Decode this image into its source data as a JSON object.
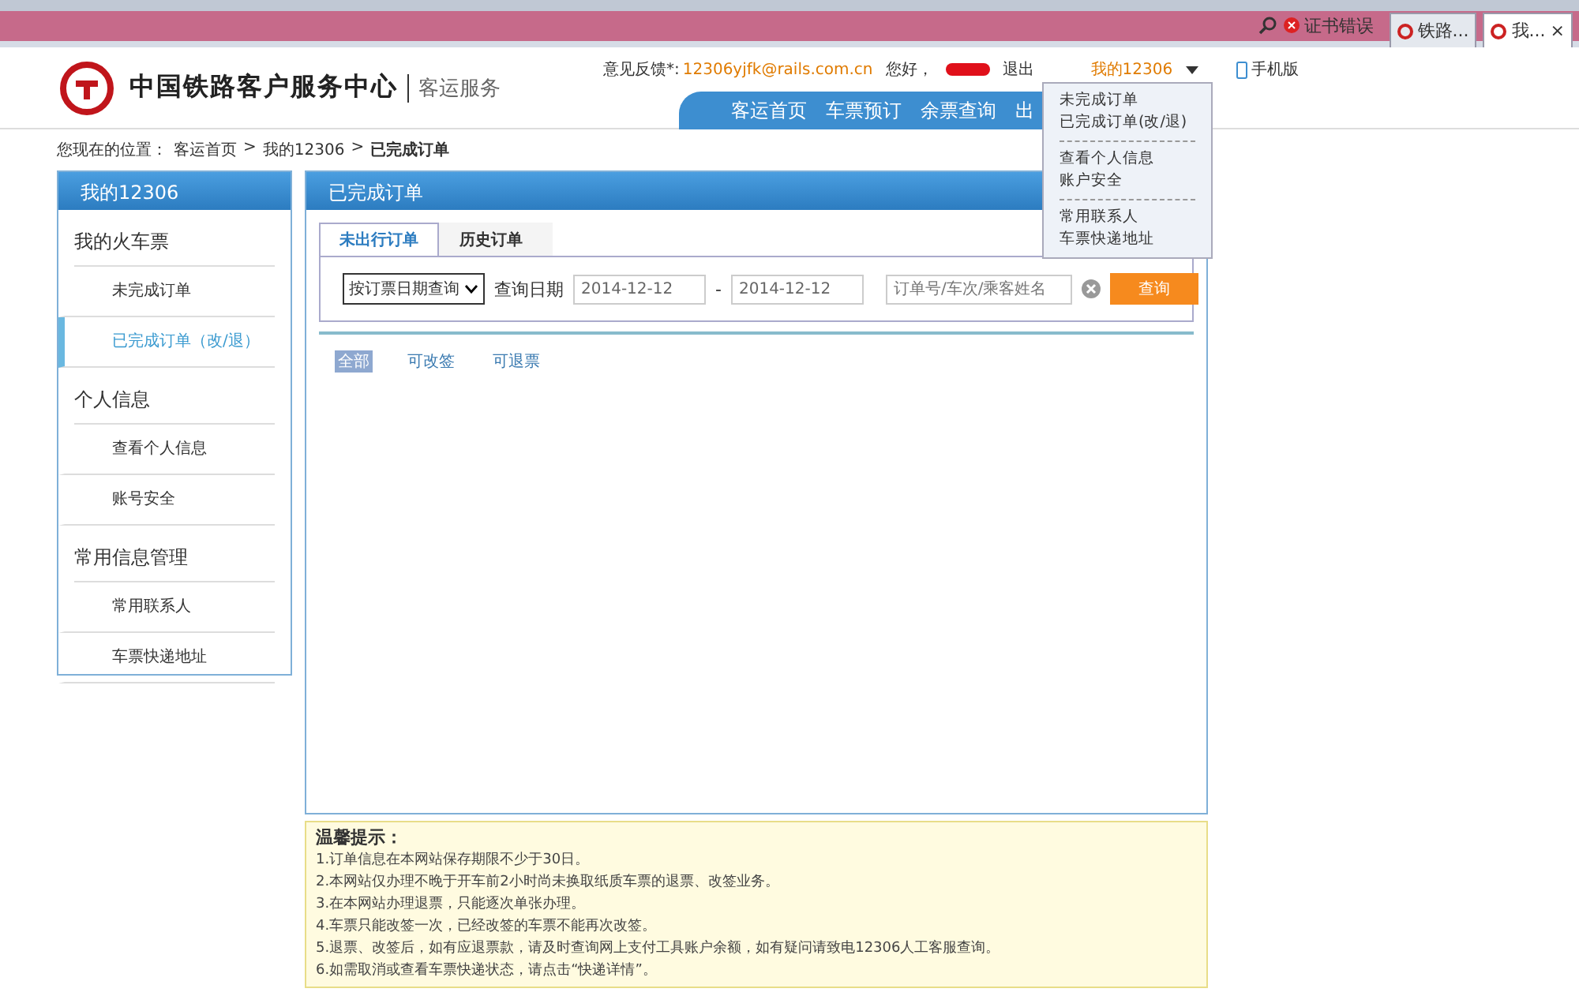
{
  "browser": {
    "certificate_error": "证书错误",
    "tabs": [
      {
        "label": "铁路...",
        "selected": false
      },
      {
        "label": "我...",
        "selected": true
      }
    ],
    "close": "×"
  },
  "header": {
    "site_name": "中国铁路客户服务中心",
    "section": "客运服务",
    "feedback_label": "意见反馈*:",
    "feedback_email": "12306yjfk@rails.com.cn",
    "greeting": "您好，",
    "logout": "退出",
    "my_account": "我的12306",
    "mobile": "手机版"
  },
  "nav": [
    {
      "label": "客运首页"
    },
    {
      "label": "车票预订"
    },
    {
      "label": "余票查询"
    },
    {
      "label": "出"
    }
  ],
  "account_menu": {
    "groups": [
      [
        "未完成订单",
        "已完成订单(改/退)"
      ],
      [
        "查看个人信息",
        "账户安全"
      ],
      [
        "常用联系人",
        "车票快递地址"
      ]
    ]
  },
  "breadcrumb": {
    "prefix": "您现在的位置：",
    "links": [
      "客运首页",
      "我的12306"
    ],
    "current": "已完成订单",
    "separator": ">"
  },
  "sidebar": {
    "title": "我的12306",
    "sections": [
      {
        "heading": "我的火车票",
        "items": [
          {
            "label": "未完成订单",
            "selected": false
          },
          {
            "label": "已完成订单（改/退）",
            "selected": true
          }
        ]
      },
      {
        "heading": "个人信息",
        "items": [
          {
            "label": "查看个人信息",
            "selected": false
          },
          {
            "label": "账号安全",
            "selected": false
          }
        ]
      },
      {
        "heading": "常用信息管理",
        "items": [
          {
            "label": "常用联系人",
            "selected": false
          },
          {
            "label": "车票快递地址",
            "selected": false
          }
        ]
      }
    ]
  },
  "panel": {
    "title": "已完成订单",
    "tabs": [
      {
        "label": "未出行订单",
        "selected": true
      },
      {
        "label": "历史订单",
        "selected": false
      }
    ],
    "query_type": "按订票日期查询",
    "date_label": "查询日期",
    "date_from": "2014-12-12",
    "date_sep": "-",
    "date_to": "2014-12-12",
    "keyword_placeholder": "订单号/车次/乘客姓名",
    "search_button": "查询",
    "filters": [
      {
        "label": "全部",
        "selected": true
      },
      {
        "label": "可改签",
        "selected": false
      },
      {
        "label": "可退票",
        "selected": false
      }
    ]
  },
  "tips": {
    "title": "温馨提示：",
    "items": [
      "1.订单信息在本网站保存期限不少于30日。",
      "2.本网站仅办理不晚于开车前2小时尚未换取纸质车票的退票、改签业务。",
      "3.在本网站办理退票，只能逐次单张办理。",
      "4.车票只能改签一次，已经改签的车票不能再次改签。",
      "5.退票、改签后，如有应退票款，请及时查询网上支付工具账户余额，如有疑问请致电12306人工客服查询。",
      "6.如需取消或查看车票快递状态，请点击“快递详情”。"
    ]
  }
}
